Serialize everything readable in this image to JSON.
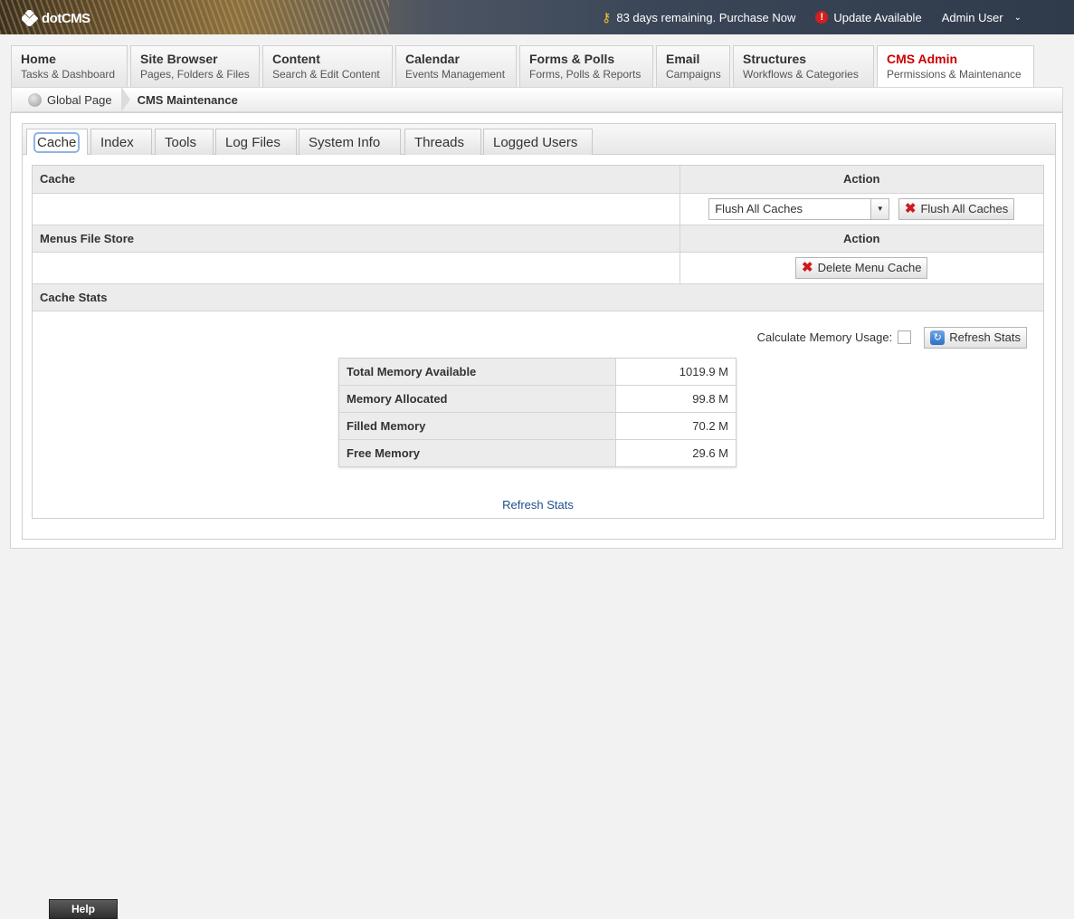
{
  "app": {
    "logo_text": "dotCMS"
  },
  "topbar": {
    "license_text": "83 days remaining. Purchase Now",
    "update_text": "Update Available",
    "user_text": "Admin User"
  },
  "nav": {
    "tabs": [
      {
        "title": "Home",
        "subtitle": "Tasks & Dashboard"
      },
      {
        "title": "Site Browser",
        "subtitle": "Pages, Folders & Files"
      },
      {
        "title": "Content",
        "subtitle": "Search & Edit Content"
      },
      {
        "title": "Calendar",
        "subtitle": "Events Management"
      },
      {
        "title": "Forms & Polls",
        "subtitle": "Forms, Polls & Reports"
      },
      {
        "title": "Email",
        "subtitle": "Campaigns"
      },
      {
        "title": "Structures",
        "subtitle": "Workflows & Categories"
      },
      {
        "title": "CMS Admin",
        "subtitle": "Permissions & Maintenance"
      }
    ],
    "active": "CMS Admin"
  },
  "breadcrumb": {
    "root": "Global Page",
    "current": "CMS Maintenance"
  },
  "subtabs": [
    "Cache",
    "Index",
    "Tools",
    "Log Files",
    "System Info",
    "Threads",
    "Logged Users"
  ],
  "cache_section": {
    "header": "Cache",
    "action_header": "Action",
    "select_value": "Flush All Caches",
    "button_label": "Flush All Caches"
  },
  "menus_section": {
    "header": "Menus File Store",
    "action_header": "Action",
    "button_label": "Delete Menu Cache"
  },
  "stats_section": {
    "header": "Cache Stats",
    "calc_label": "Calculate Memory Usage:",
    "refresh_button": "Refresh Stats",
    "rows": [
      {
        "label": "Total Memory Available",
        "value": "1019.9 M"
      },
      {
        "label": "Memory Allocated",
        "value": "99.8 M"
      },
      {
        "label": "Filled Memory",
        "value": "70.2 M"
      },
      {
        "label": "Free Memory",
        "value": "29.6 M"
      }
    ],
    "refresh_link": "Refresh Stats"
  },
  "help": {
    "label": "Help"
  }
}
